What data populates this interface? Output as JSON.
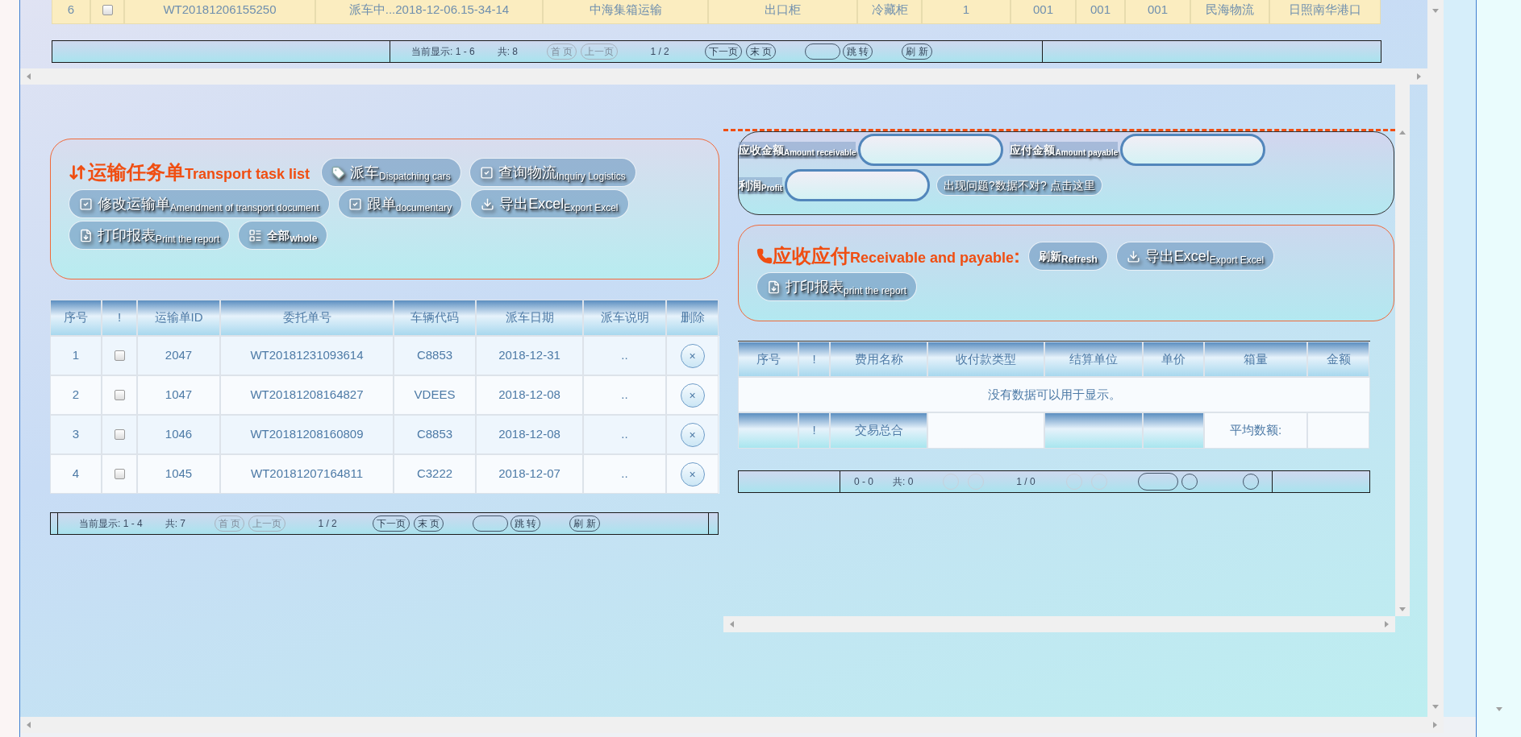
{
  "top_table": {
    "row": {
      "checked": false,
      "cells": [
        "6",
        "WT20181206155250",
        "派车中...2018-12-06.15-34-14",
        "中海集箱运输",
        "出口柜",
        "冷藏柜",
        "1",
        "001",
        "001",
        "001",
        "民海物流",
        "日照南华港口"
      ]
    }
  },
  "top_pager": {
    "display": "当前显示: 1 - 6",
    "total": "共: 8",
    "page": "1 / 2",
    "buttons_before": [
      {
        "label": "首 页",
        "disabled": true
      },
      {
        "label": "上一页",
        "disabled": true
      }
    ],
    "buttons_after": [
      {
        "label": "下一页",
        "disabled": false
      },
      {
        "label": "末 页",
        "disabled": false
      }
    ],
    "go": "跳 转",
    "refresh": "刷 新"
  },
  "task_panel": {
    "title": "运输任务单",
    "title_en": "Transport task list",
    "buttons": [
      {
        "kind": "tag",
        "label": "派车",
        "sub": "Dispatching cars"
      },
      {
        "kind": "check",
        "label": "查询物流",
        "sub": "Inquiry Logistics"
      },
      {
        "kind": "check",
        "label": "修改运输单",
        "sub": "Amendment of transport document"
      },
      {
        "kind": "check",
        "label": "跟单",
        "sub": "documentary"
      },
      {
        "kind": "download",
        "label": "导出Excel",
        "sub": "Export Excel"
      },
      {
        "kind": "file",
        "label": "打印报表",
        "sub": "Print the report"
      },
      {
        "kind": "list",
        "label": "全部",
        "sub": "whole"
      }
    ]
  },
  "task_table": {
    "columns": [
      "序号",
      "!",
      "运输单ID",
      "委托单号",
      "车辆代码",
      "派车日期",
      "派车说明",
      "删除"
    ],
    "rows": [
      {
        "no": "1",
        "checked": false,
        "id": "2047",
        "order": "WT20181231093614",
        "vehicle": "C8853",
        "date": "2018-12-31",
        "note": "..",
        "delete": "×"
      },
      {
        "no": "2",
        "checked": false,
        "id": "1047",
        "order": "WT20181208164827",
        "vehicle": "VDEES",
        "date": "2018-12-08",
        "note": "..",
        "delete": "×"
      },
      {
        "no": "3",
        "checked": false,
        "id": "1046",
        "order": "WT20181208160809",
        "vehicle": "C8853",
        "date": "2018-12-08",
        "note": "..",
        "delete": "×"
      },
      {
        "no": "4",
        "checked": false,
        "id": "1045",
        "order": "WT20181207164811",
        "vehicle": "C3222",
        "date": "2018-12-07",
        "note": "..",
        "delete": "×"
      }
    ]
  },
  "task_pager": {
    "display": "当前显示: 1 - 4",
    "total": "共: 7",
    "page": "1 / 2",
    "buttons_before": [
      {
        "label": "首 页",
        "disabled": true
      },
      {
        "label": "上一页",
        "disabled": true
      }
    ],
    "buttons_after": [
      {
        "label": "下一页",
        "disabled": false
      },
      {
        "label": "末 页",
        "disabled": false
      }
    ],
    "go": "跳 转",
    "refresh": "刷 新"
  },
  "amounts": {
    "fields": [
      {
        "label": "应收金额",
        "sub": "Amount receivable"
      },
      {
        "label": "应付金额",
        "sub": "Amount payable"
      },
      {
        "label": "利润",
        "sub": "Profit"
      }
    ],
    "help": "出现问题?数据不对? 点击这里"
  },
  "payable_panel": {
    "title": "应收应付",
    "title_en": "Receivable and payable",
    "colon": ":",
    "buttons": [
      {
        "kind": "plain",
        "label": "刷新",
        "sub": "Refresh"
      },
      {
        "kind": "download",
        "label": "导出Excel",
        "sub": "Export Excel"
      },
      {
        "kind": "file",
        "label": "打印报表",
        "sub": "print the report"
      }
    ]
  },
  "fee_table": {
    "columns": [
      "序号",
      "!",
      "费用名称",
      "收付款类型",
      "结算单位",
      "单价",
      "箱量",
      "金额"
    ],
    "empty": "没有数据可以用于显示。",
    "footer": [
      {
        "kind": "header"
      },
      {
        "kind": "header",
        "text": "!"
      },
      {
        "kind": "header",
        "text": "交易总合"
      },
      {
        "kind": "plain"
      },
      {
        "kind": "header"
      },
      {
        "kind": "header"
      },
      {
        "kind": "plain",
        "text": "平均数额:"
      },
      {
        "kind": "plain"
      }
    ]
  },
  "fee_pager": {
    "display": "0 - 0",
    "total": "共: 0",
    "page": "1 / 0"
  }
}
